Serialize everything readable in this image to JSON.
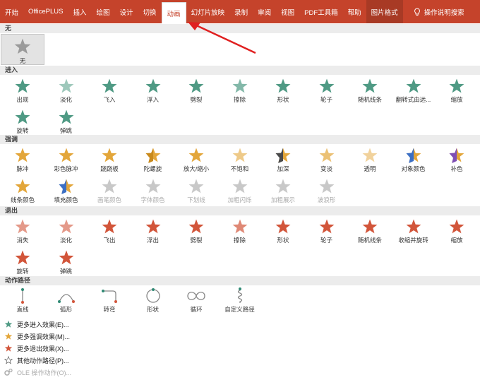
{
  "ribbon": {
    "tabs": [
      {
        "label": "开始",
        "active": false
      },
      {
        "label": "OfficePLUS",
        "active": false
      },
      {
        "label": "插入",
        "active": false
      },
      {
        "label": "绘图",
        "active": false
      },
      {
        "label": "设计",
        "active": false
      },
      {
        "label": "切换",
        "active": false
      },
      {
        "label": "动画",
        "active": true
      },
      {
        "label": "幻灯片放映",
        "active": false
      },
      {
        "label": "录制",
        "active": false
      },
      {
        "label": "审阅",
        "active": false
      },
      {
        "label": "视图",
        "active": false
      },
      {
        "label": "PDF工具箱",
        "active": false
      },
      {
        "label": "帮助",
        "active": false
      },
      {
        "label": "图片格式",
        "active": false
      }
    ],
    "tell_me": "操作说明搜索"
  },
  "colors": {
    "ribbon": "#c5432b",
    "entrance": "#4f9a84",
    "emphasis": "#e3a63a",
    "exit": "#d2553a",
    "path": "#2f8a74"
  },
  "sections": {
    "none": {
      "title": "无",
      "items": [
        {
          "label": "无",
          "icon": "gray-star-icon"
        }
      ]
    },
    "entrance": {
      "title": "进入",
      "items": [
        {
          "label": "出现",
          "icon": "star-appear-icon"
        },
        {
          "label": "淡化",
          "icon": "star-fade-icon"
        },
        {
          "label": "飞入",
          "icon": "star-fly-in-icon"
        },
        {
          "label": "浮入",
          "icon": "star-float-in-icon"
        },
        {
          "label": "劈裂",
          "icon": "star-split-icon"
        },
        {
          "label": "擦除",
          "icon": "star-wipe-icon"
        },
        {
          "label": "形状",
          "icon": "star-shape-icon"
        },
        {
          "label": "轮子",
          "icon": "star-wheel-icon"
        },
        {
          "label": "随机线条",
          "icon": "star-random-bars-icon"
        },
        {
          "label": "翻转式由远...",
          "icon": "star-grow-turn-icon"
        },
        {
          "label": "缩放",
          "icon": "star-zoom-icon"
        },
        {
          "label": "旋转",
          "icon": "star-swivel-icon"
        },
        {
          "label": "弹跳",
          "icon": "star-bounce-icon"
        }
      ]
    },
    "emphasis": {
      "title": "强调",
      "items": [
        {
          "label": "脉冲",
          "icon": "star-pulse-icon",
          "disabled": false
        },
        {
          "label": "彩色脉冲",
          "icon": "star-color-pulse-icon",
          "disabled": false
        },
        {
          "label": "跷跷板",
          "icon": "star-teeter-icon",
          "disabled": false
        },
        {
          "label": "陀螺旋",
          "icon": "star-spin-icon",
          "disabled": false
        },
        {
          "label": "放大/缩小",
          "icon": "star-grow-shrink-icon",
          "disabled": false
        },
        {
          "label": "不饱和",
          "icon": "star-desaturate-icon",
          "disabled": false
        },
        {
          "label": "加深",
          "icon": "star-darken-icon",
          "disabled": false
        },
        {
          "label": "变淡",
          "icon": "star-lighten-icon",
          "disabled": false
        },
        {
          "label": "透明",
          "icon": "star-transparency-icon",
          "disabled": false
        },
        {
          "label": "对象颜色",
          "icon": "star-object-color-icon",
          "disabled": false
        },
        {
          "label": "补色",
          "icon": "star-complementary-icon",
          "disabled": false
        },
        {
          "label": "线条颜色",
          "icon": "star-line-color-icon",
          "disabled": false
        },
        {
          "label": "填充颜色",
          "icon": "star-fill-color-icon",
          "disabled": false
        },
        {
          "label": "画笔颜色",
          "icon": "star-brush-color-icon",
          "disabled": true
        },
        {
          "label": "字体颜色",
          "icon": "star-font-color-icon",
          "disabled": true
        },
        {
          "label": "下划线",
          "icon": "star-underline-icon",
          "disabled": true
        },
        {
          "label": "加粗闪烁",
          "icon": "star-bold-flash-icon",
          "disabled": true
        },
        {
          "label": "加粗展示",
          "icon": "star-bold-reveal-icon",
          "disabled": true
        },
        {
          "label": "波浪形",
          "icon": "star-wave-icon",
          "disabled": true
        }
      ]
    },
    "exit": {
      "title": "退出",
      "items": [
        {
          "label": "消失",
          "icon": "star-disappear-icon"
        },
        {
          "label": "淡化",
          "icon": "star-fade-out-icon"
        },
        {
          "label": "飞出",
          "icon": "star-fly-out-icon"
        },
        {
          "label": "浮出",
          "icon": "star-float-out-icon"
        },
        {
          "label": "劈裂",
          "icon": "star-split-out-icon"
        },
        {
          "label": "擦除",
          "icon": "star-wipe-out-icon"
        },
        {
          "label": "形状",
          "icon": "star-shape-out-icon"
        },
        {
          "label": "轮子",
          "icon": "star-wheel-out-icon"
        },
        {
          "label": "随机线条",
          "icon": "star-random-bars-out-icon"
        },
        {
          "label": "收缩并旋转",
          "icon": "star-shrink-turn-icon"
        },
        {
          "label": "缩放",
          "icon": "star-zoom-out-icon"
        },
        {
          "label": "旋转",
          "icon": "star-swivel-out-icon"
        },
        {
          "label": "弹跳",
          "icon": "star-bounce-out-icon"
        }
      ]
    },
    "paths": {
      "title": "动作路径",
      "items": [
        {
          "label": "直线",
          "icon": "path-line-icon"
        },
        {
          "label": "弧形",
          "icon": "path-arc-icon"
        },
        {
          "label": "转弯",
          "icon": "path-turn-icon"
        },
        {
          "label": "形状",
          "icon": "path-shape-icon"
        },
        {
          "label": "循环",
          "icon": "path-loop-icon"
        },
        {
          "label": "自定义路径",
          "icon": "path-custom-icon"
        }
      ]
    }
  },
  "more": [
    {
      "label": "更多进入效果(E)...",
      "icon": "green-star-icon",
      "disabled": false
    },
    {
      "label": "更多强调效果(M)...",
      "icon": "yellow-star-icon",
      "disabled": false
    },
    {
      "label": "更多退出效果(X)...",
      "icon": "red-star-icon",
      "disabled": false
    },
    {
      "label": "其他动作路径(P)...",
      "icon": "outline-star-icon",
      "disabled": false
    },
    {
      "label": "OLE 操作动作(O)...",
      "icon": "gears-icon",
      "disabled": true
    }
  ]
}
